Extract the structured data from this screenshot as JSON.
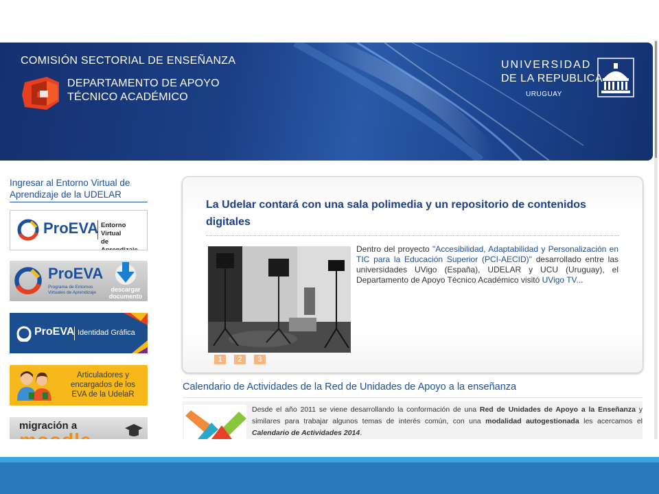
{
  "header": {
    "institution": "COMISIÓN SECTORIAL DE ENSEÑANZA",
    "department_line1": "DEPARTAMENTO DE APOYO",
    "department_line2": "TÉCNICO ACADÉMICO",
    "university_line1": "UNIVERSIDAD",
    "university_line2": "DE LA REPUBLICA",
    "university_line3": "URUGUAY",
    "colors": {
      "banner": "#1b3f86",
      "logo": "#e8401f"
    }
  },
  "sidebar": {
    "link": "Ingresar al Entorno Virtual de Aprendizaje de la UDELAR",
    "buttons": [
      {
        "brand": "ProEVA",
        "caption_line1": "Entorno Virtual",
        "caption_line2": "de Aprendizaje"
      },
      {
        "brand": "ProEVA",
        "caption_line1": "Programa de Entornos",
        "caption_line2": "Virtuales de Aprendizaje",
        "action_line1": "descargar",
        "action_line2": "documento"
      },
      {
        "brand": "ProEVA",
        "caption_line1": "Identidad Gráfica"
      },
      {
        "caption_line1": "Articuladores y",
        "caption_line2": "encargados de los",
        "caption_line3": "EVA de la UdelaR"
      },
      {
        "caption_line1": "migración a",
        "caption_line2": "moodle"
      }
    ]
  },
  "featured": {
    "title": "La Udelar contará con una sala polimedia y un repositorio de contenidos digitales",
    "text_before": "Dentro del proyecto ",
    "project_link": "\"Accesibilidad, Adaptabilidad y Personalización en TIC para la Educación Superior (PCI-AECID)\"",
    "text_middle": " desarrollado entre las universidades UVigo (España), UDELAR y UCU (Uruguay), el Departamento de Apoyo Técnico Académico visitó ",
    "more_link": "UVigo TV...",
    "pages": [
      "1",
      "2",
      "3"
    ]
  },
  "calendar": {
    "title": "Calendario de Actividades de la Red de Unidades de Apoyo a la enseñanza",
    "text_part1": "Desde el año 2011 se viene desarrollando la conformación de una ",
    "bold1": "Red de Unidades de Apoyo a la Enseñanza",
    "text_part2": " y similares para trabajar algunos temas de interés común, con una ",
    "bold2": "modalidad autogestionada",
    "text_part3": " les acercamos el ",
    "bold_italic": "Calendario de Actividades 2014",
    "text_end": "."
  }
}
